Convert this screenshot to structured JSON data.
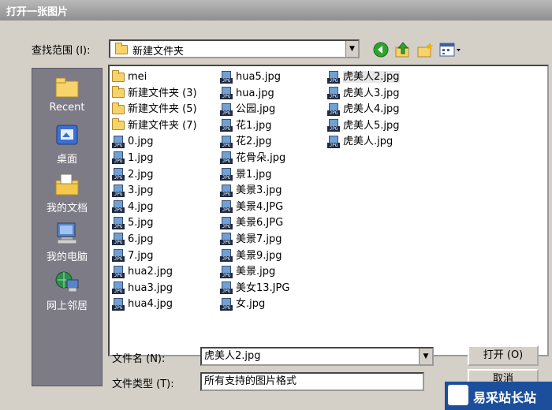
{
  "window": {
    "title": "打开一张图片"
  },
  "lookin": {
    "label": "查找范围 (I):",
    "value": "新建文件夹"
  },
  "toolbar": {
    "icons": [
      "back-icon",
      "up-folder-icon",
      "new-folder-icon",
      "view-menu-icon"
    ]
  },
  "places": [
    {
      "label": "Recent",
      "icon": "recent-folder-icon"
    },
    {
      "label": "桌面",
      "icon": "desktop-icon"
    },
    {
      "label": "我的文档",
      "icon": "my-documents-icon"
    },
    {
      "label": "我的电脑",
      "icon": "my-computer-icon"
    },
    {
      "label": "网上邻居",
      "icon": "network-icon"
    }
  ],
  "files": {
    "col1": [
      {
        "name": "mei",
        "type": "folder"
      },
      {
        "name": "新建文件夹 (3)",
        "type": "folder"
      },
      {
        "name": "新建文件夹 (5)",
        "type": "folder"
      },
      {
        "name": "新建文件夹 (7)",
        "type": "folder"
      },
      {
        "name": "0.jpg",
        "type": "jpg"
      },
      {
        "name": "1.jpg",
        "type": "jpg"
      },
      {
        "name": "2.jpg",
        "type": "jpg"
      },
      {
        "name": "3.jpg",
        "type": "jpg"
      },
      {
        "name": "4.jpg",
        "type": "jpg"
      },
      {
        "name": "5.jpg",
        "type": "jpg"
      },
      {
        "name": "6.jpg",
        "type": "jpg"
      },
      {
        "name": "7.jpg",
        "type": "jpg"
      },
      {
        "name": "hua2.jpg",
        "type": "jpg"
      },
      {
        "name": "hua3.jpg",
        "type": "jpg"
      },
      {
        "name": "hua4.jpg",
        "type": "jpg"
      }
    ],
    "col2": [
      {
        "name": "hua5.jpg",
        "type": "jpg"
      },
      {
        "name": "hua.jpg",
        "type": "jpg"
      },
      {
        "name": "公园.jpg",
        "type": "jpg"
      },
      {
        "name": "花1.jpg",
        "type": "jpg"
      },
      {
        "name": "花2.jpg",
        "type": "jpg"
      },
      {
        "name": "花骨朵.jpg",
        "type": "jpg"
      },
      {
        "name": "景1.jpg",
        "type": "jpg"
      },
      {
        "name": "美景3.jpg",
        "type": "jpg"
      },
      {
        "name": "美景4.JPG",
        "type": "jpg"
      },
      {
        "name": "美景6.JPG",
        "type": "jpg"
      },
      {
        "name": "美景7.jpg",
        "type": "jpg"
      },
      {
        "name": "美景9.jpg",
        "type": "jpg"
      },
      {
        "name": "美景.jpg",
        "type": "jpg"
      },
      {
        "name": "美女13.JPG",
        "type": "jpg"
      },
      {
        "name": "女.jpg",
        "type": "jpg"
      }
    ],
    "col3": [
      {
        "name": "虎美人2.jpg",
        "type": "jpg",
        "selected": true
      },
      {
        "name": "虎美人3.jpg",
        "type": "jpg"
      },
      {
        "name": "虎美人4.jpg",
        "type": "jpg"
      },
      {
        "name": "虎美人5.jpg",
        "type": "jpg"
      },
      {
        "name": "虎美人.jpg",
        "type": "jpg"
      }
    ]
  },
  "filename": {
    "label": "文件名 (N):",
    "value": "虎美人2.jpg"
  },
  "filetype": {
    "label": "文件类型 (T):",
    "value": "所有支持的图片格式"
  },
  "buttons": {
    "open": "打开 (O)",
    "cancel": "取消"
  },
  "watermark": {
    "text": "易采站长站"
  },
  "colors": {
    "titlebar": "#9a9a9a",
    "dialog": "#d4d0c8",
    "sidebar": "#7d7b86",
    "watermark": "#1b4f9c"
  }
}
